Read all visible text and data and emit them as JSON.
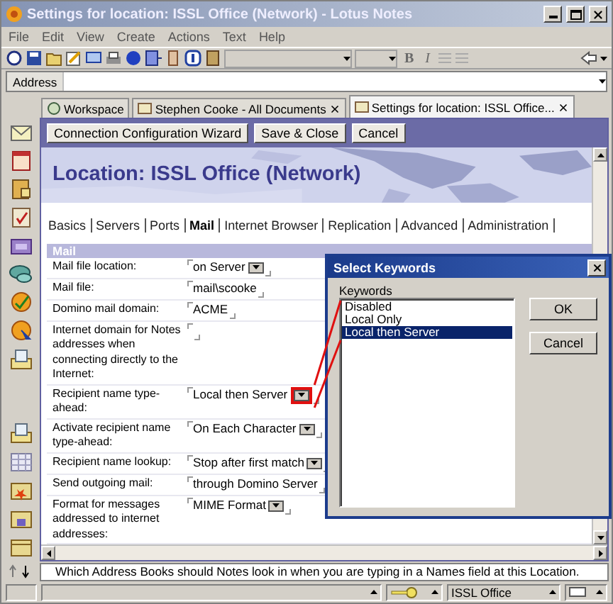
{
  "window": {
    "title": "Settings for location: ISSL Office (Network) - Lotus Notes"
  },
  "menu": [
    "File",
    "Edit",
    "View",
    "Create",
    "Actions",
    "Text",
    "Help"
  ],
  "format_buttons": [
    "B",
    "I"
  ],
  "address": {
    "label": "Address"
  },
  "doc_tabs": [
    {
      "label": "Workspace",
      "selected": false,
      "closable": false
    },
    {
      "label": "Stephen Cooke - All Documents",
      "selected": false,
      "closable": true
    },
    {
      "label": "Settings for location: ISSL Office...",
      "selected": true,
      "closable": true
    }
  ],
  "actions": [
    "Connection Configuration Wizard",
    "Save & Close",
    "Cancel"
  ],
  "form": {
    "title": "Location: ISSL Office (Network)",
    "tabs": [
      {
        "label": "Basics",
        "selected": false
      },
      {
        "label": "Servers",
        "selected": false
      },
      {
        "label": "Ports",
        "selected": false
      },
      {
        "label": "Mail",
        "selected": true
      },
      {
        "label": "Internet Browser",
        "selected": false
      },
      {
        "label": "Replication",
        "selected": false
      },
      {
        "label": "Advanced",
        "selected": false
      },
      {
        "label": "Administration",
        "selected": false
      }
    ],
    "section": "Mail",
    "fields": [
      {
        "label": "Mail file location:",
        "value": "on Server",
        "kind": "dropdown",
        "highlighted": false
      },
      {
        "label": "Mail file:",
        "value": "mail\\scooke",
        "kind": "text",
        "highlighted": false
      },
      {
        "label": "Domino mail domain:",
        "value": "ACME",
        "kind": "text",
        "highlighted": false
      },
      {
        "label": "Internet domain for Notes addresses when connecting directly to the Internet:",
        "kind": "text",
        "highlighted": false
      },
      {
        "label": "Recipient name type-ahead:",
        "value": "Local then Server",
        "kind": "dropdown",
        "highlighted": true
      },
      {
        "label": "Activate recipient name type-ahead:",
        "value": "On Each Character",
        "kind": "dropdown",
        "highlighted": false
      },
      {
        "label": "Recipient name lookup:",
        "value": "Stop after first match",
        "kind": "dropdown",
        "highlighted": false
      },
      {
        "label": "Send outgoing mail:",
        "value": "through Domino Server",
        "kind": "text",
        "highlighted": false
      },
      {
        "label": "Format for messages addressed to internet addresses:",
        "value": "MIME Format",
        "kind": "dropdown",
        "highlighted": false
      }
    ]
  },
  "dialog": {
    "title": "Select Keywords",
    "list_label": "Keywords",
    "options": [
      {
        "label": "Disabled",
        "selected": false
      },
      {
        "label": "Local Only",
        "selected": false
      },
      {
        "label": "Local then Server",
        "selected": true
      }
    ],
    "buttons": [
      "OK",
      "Cancel"
    ]
  },
  "hint": "Which Address Books should Notes look in when you are typing in a Names field at this Location.",
  "status_bar": {
    "location": "ISSL Office"
  }
}
